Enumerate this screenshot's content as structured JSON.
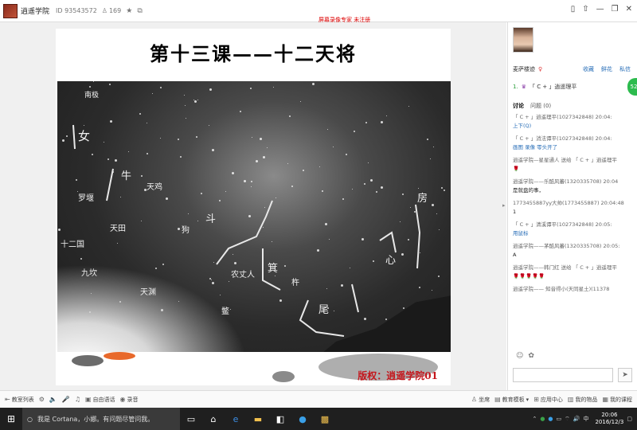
{
  "titlebar": {
    "room_name": "逍遥学院",
    "room_id": "ID 93543572",
    "fans": "169",
    "notice": "屏幕录像专家 未注册"
  },
  "slide": {
    "title": "第十三课——十二天将",
    "watermark": "版权：逍遥学院01",
    "labels": {
      "l1": "南极",
      "l2": "女",
      "l3": "牛",
      "l4": "罗堰",
      "l5": "天鸡",
      "l6": "天田",
      "l7": "狗",
      "l8": "十二国",
      "l9": "九坎",
      "l10": "天渊",
      "l11": "斗",
      "l12": "农丈人",
      "l13": "箕",
      "l14": "杵",
      "l15": "尾",
      "l16": "鳖",
      "l17": "房",
      "l18": "心"
    }
  },
  "teacher": {
    "name": "麦萨楼迹",
    "actions": [
      "收藏",
      "鲜花",
      "私信"
    ]
  },
  "assistant": {
    "rank": "1.",
    "name": "「 C + 」逍遥理平"
  },
  "tabs": {
    "discuss": "讨论",
    "question": "问题 (0)"
  },
  "chat": [
    {
      "who": "「 C + 」逍遥理平(1027342848) 20:04:",
      "text": "上下(Q)",
      "blue": true
    },
    {
      "who": "「 C + 」消法谭平(1027342848) 20:04:",
      "text": "画图 录像 零头开了",
      "blue": true
    },
    {
      "who": "逍遥学院—星星通人 送给 「 C + 」逍遥理平",
      "text": "🌹",
      "blue": false
    },
    {
      "who": "逍遥学院——乐酷风蕃(1320335708) 20:04",
      "text": "是就盘的事，",
      "blue": false
    },
    {
      "who": "1773455887yy大帅(1773455887) 20:04:48",
      "text": "1",
      "blue": false
    },
    {
      "who": "「 C + 」清溪谭平(1027342848) 20:05:",
      "text": "用鼠标",
      "blue": true
    },
    {
      "who": "逍遥学院——茅酷风蕃(1320335708) 20:05:",
      "text": "A",
      "blue": false
    },
    {
      "who": "逍遥学院——韩门红 送给 「 C + 」逍遥理平",
      "text": "🌹🌹🌹🌹🌹",
      "blue": false
    },
    {
      "who": "逍遥学院—— 知音得小(天同星土)(11378",
      "text": "",
      "blue": false
    }
  ],
  "toolbar": {
    "class_list": "教室列表",
    "free_talk": "自由语话",
    "recording": "录音",
    "seat": "坐席",
    "teaching_template": "教育模板",
    "app_center": "应用中心",
    "my_items": "我的物品",
    "my_courses": "我的课程"
  },
  "taskbar": {
    "cortana": "我是 Cortana，小娜。有问题尽管问我。",
    "tray_lang": "中",
    "time": "20:06",
    "date": "2016/12/3"
  }
}
